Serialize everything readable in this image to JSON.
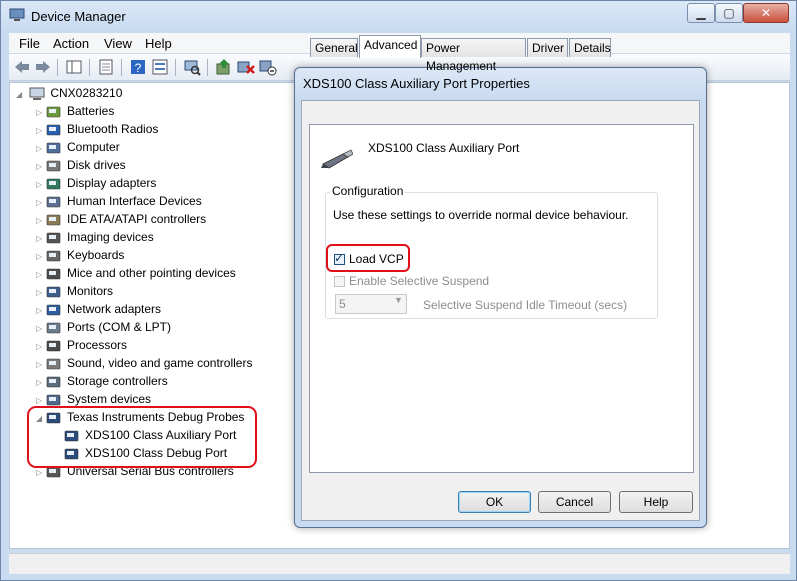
{
  "window": {
    "title": "Device Manager"
  },
  "menu": [
    "File",
    "Action",
    "View",
    "Help"
  ],
  "tree": {
    "root": "CNX0283210",
    "categories": [
      {
        "label": "Batteries",
        "icon": "battery-icon"
      },
      {
        "label": "Bluetooth Radios",
        "icon": "bluetooth-icon"
      },
      {
        "label": "Computer",
        "icon": "computer-icon"
      },
      {
        "label": "Disk drives",
        "icon": "disk-drive-icon"
      },
      {
        "label": "Display adapters",
        "icon": "display-adapter-icon"
      },
      {
        "label": "Human Interface Devices",
        "icon": "hid-icon"
      },
      {
        "label": "IDE ATA/ATAPI controllers",
        "icon": "ide-controller-icon"
      },
      {
        "label": "Imaging devices",
        "icon": "camera-icon"
      },
      {
        "label": "Keyboards",
        "icon": "keyboard-icon"
      },
      {
        "label": "Mice and other pointing devices",
        "icon": "mouse-icon"
      },
      {
        "label": "Monitors",
        "icon": "monitor-icon"
      },
      {
        "label": "Network adapters",
        "icon": "network-icon"
      },
      {
        "label": "Ports (COM & LPT)",
        "icon": "port-icon"
      },
      {
        "label": "Processors",
        "icon": "processor-icon"
      },
      {
        "label": "Sound, video and game controllers",
        "icon": "speaker-icon"
      },
      {
        "label": "Storage controllers",
        "icon": "storage-icon"
      },
      {
        "label": "System devices",
        "icon": "system-device-icon"
      },
      {
        "label": "Texas Instruments Debug Probes",
        "icon": "ti-probe-icon",
        "expanded": true,
        "children": [
          "XDS100 Class Auxiliary Port",
          "XDS100 Class Debug Port"
        ]
      },
      {
        "label": "Universal Serial Bus controllers",
        "icon": "usb-icon"
      }
    ]
  },
  "dialog": {
    "title": "XDS100 Class Auxiliary Port Properties",
    "tabs": [
      "General",
      "Advanced",
      "Power Management",
      "Driver",
      "Details"
    ],
    "active_tab": "Advanced",
    "device_name": "XDS100 Class Auxiliary Port",
    "group_label": "Configuration",
    "description": "Use these settings to override normal device behaviour.",
    "load_vcp": {
      "label": "Load VCP",
      "checked": true
    },
    "selective_suspend": {
      "label": "Enable Selective Suspend",
      "checked": false,
      "enabled": false
    },
    "timeout": {
      "value": "5",
      "label": "Selective Suspend Idle Timeout (secs)"
    },
    "buttons": {
      "ok": "OK",
      "cancel": "Cancel",
      "help": "Help"
    }
  }
}
